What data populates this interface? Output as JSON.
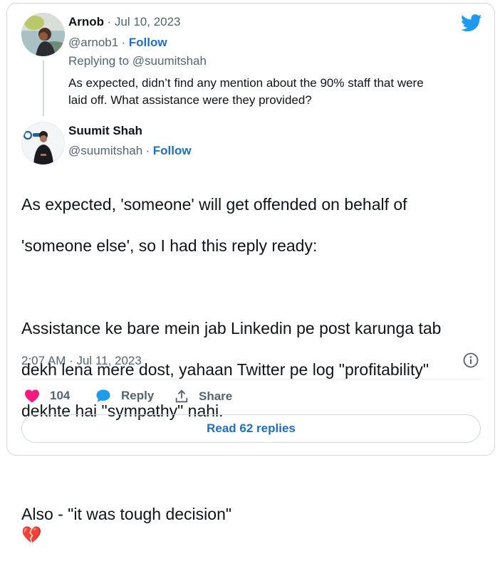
{
  "reply_tweet": {
    "author_name": "Arnob",
    "date": "· Jul 10, 2023",
    "handle": "@arnob1",
    "follow_label": "Follow",
    "replying_to": "Replying to @suumitshah",
    "text_line1": "As expected, didn’t find any mention about the 90% staff that were",
    "text_line2": "laid off. What assistance were they provided?"
  },
  "main_tweet": {
    "author_name": "Suumit Shah",
    "handle": "@suumitshah",
    "follow_label": "Follow",
    "text_p1_line1": "As expected, 'someone' will get offended on behalf of",
    "text_p1_line2": "'someone else', so I had this reply ready:",
    "text_p2_line1": "Assistance ke bare mein jab Linkedin pe post karunga tab",
    "text_p2_line2": "dekh lena mere dost, yahaan Twitter pe log \"profitability\"",
    "text_p2_line3": "dekhte hai \"sympathy\" nahi.",
    "text_p3": "Also - \"it was tough decision\"",
    "emoji": "💔",
    "timestamp": "2:07 AM · Jul 11, 2023"
  },
  "actions": {
    "like_count": "104",
    "reply_label": "Reply",
    "share_label": "Share"
  },
  "read_replies_label": "Read 62 replies",
  "icons": {
    "brand": "twitter-bird-icon",
    "info": "info-icon",
    "like": "heart-icon",
    "reply": "speech-bubble-icon",
    "share": "share-upload-icon"
  },
  "colors": {
    "twitter_blue": "#1d9bf0",
    "link_blue": "#1d6fc4",
    "like_pink": "#f91880",
    "text": "#0f1419",
    "muted": "#536471",
    "border": "#cfd9de"
  }
}
